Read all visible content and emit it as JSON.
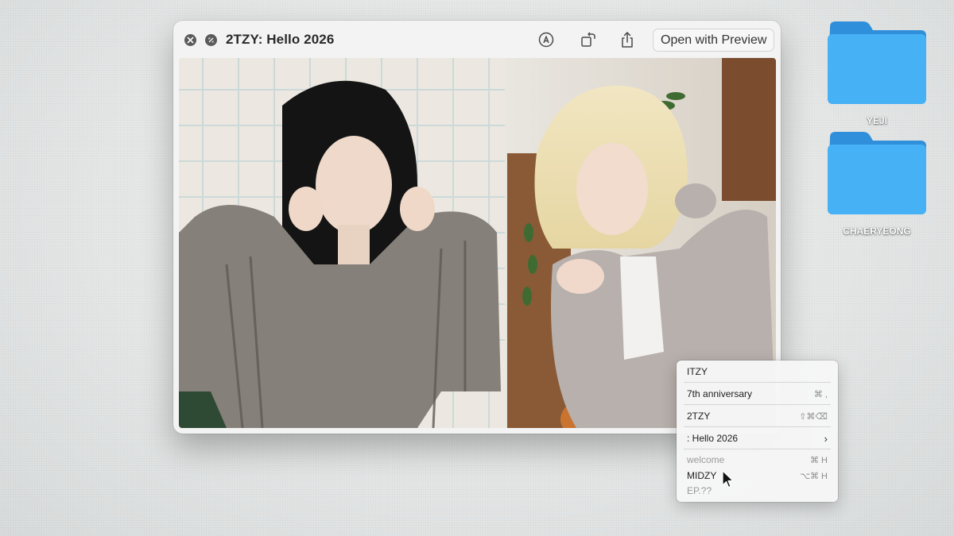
{
  "window": {
    "title": "2TZY: Hello 2026",
    "open_button_label": "Open with Preview",
    "icons": [
      "close-icon",
      "fullscreen-icon",
      "markup-icon",
      "rotate-icon",
      "share-icon"
    ]
  },
  "photo": {
    "description_icon": "photo-of-two-women-posing"
  },
  "desktop": {
    "folders": [
      {
        "label": "YEJI"
      },
      {
        "label": "CHAERYEONG"
      }
    ],
    "folder_color": "#3aa9f2"
  },
  "context_menu": {
    "items": [
      {
        "label": "ITZY",
        "shortcut": ""
      },
      {
        "label": "7th anniversary",
        "shortcut": "⌘ ,"
      },
      {
        "label": "2TZY",
        "shortcut": "⇧⌘⌫"
      },
      {
        "label": ": Hello 2026",
        "shortcut": "›"
      },
      {
        "label": "welcome",
        "shortcut": "⌘ H"
      },
      {
        "label": "MIDZY",
        "shortcut": "⌥⌘ H"
      },
      {
        "label": "EP.??",
        "shortcut": ""
      }
    ]
  }
}
